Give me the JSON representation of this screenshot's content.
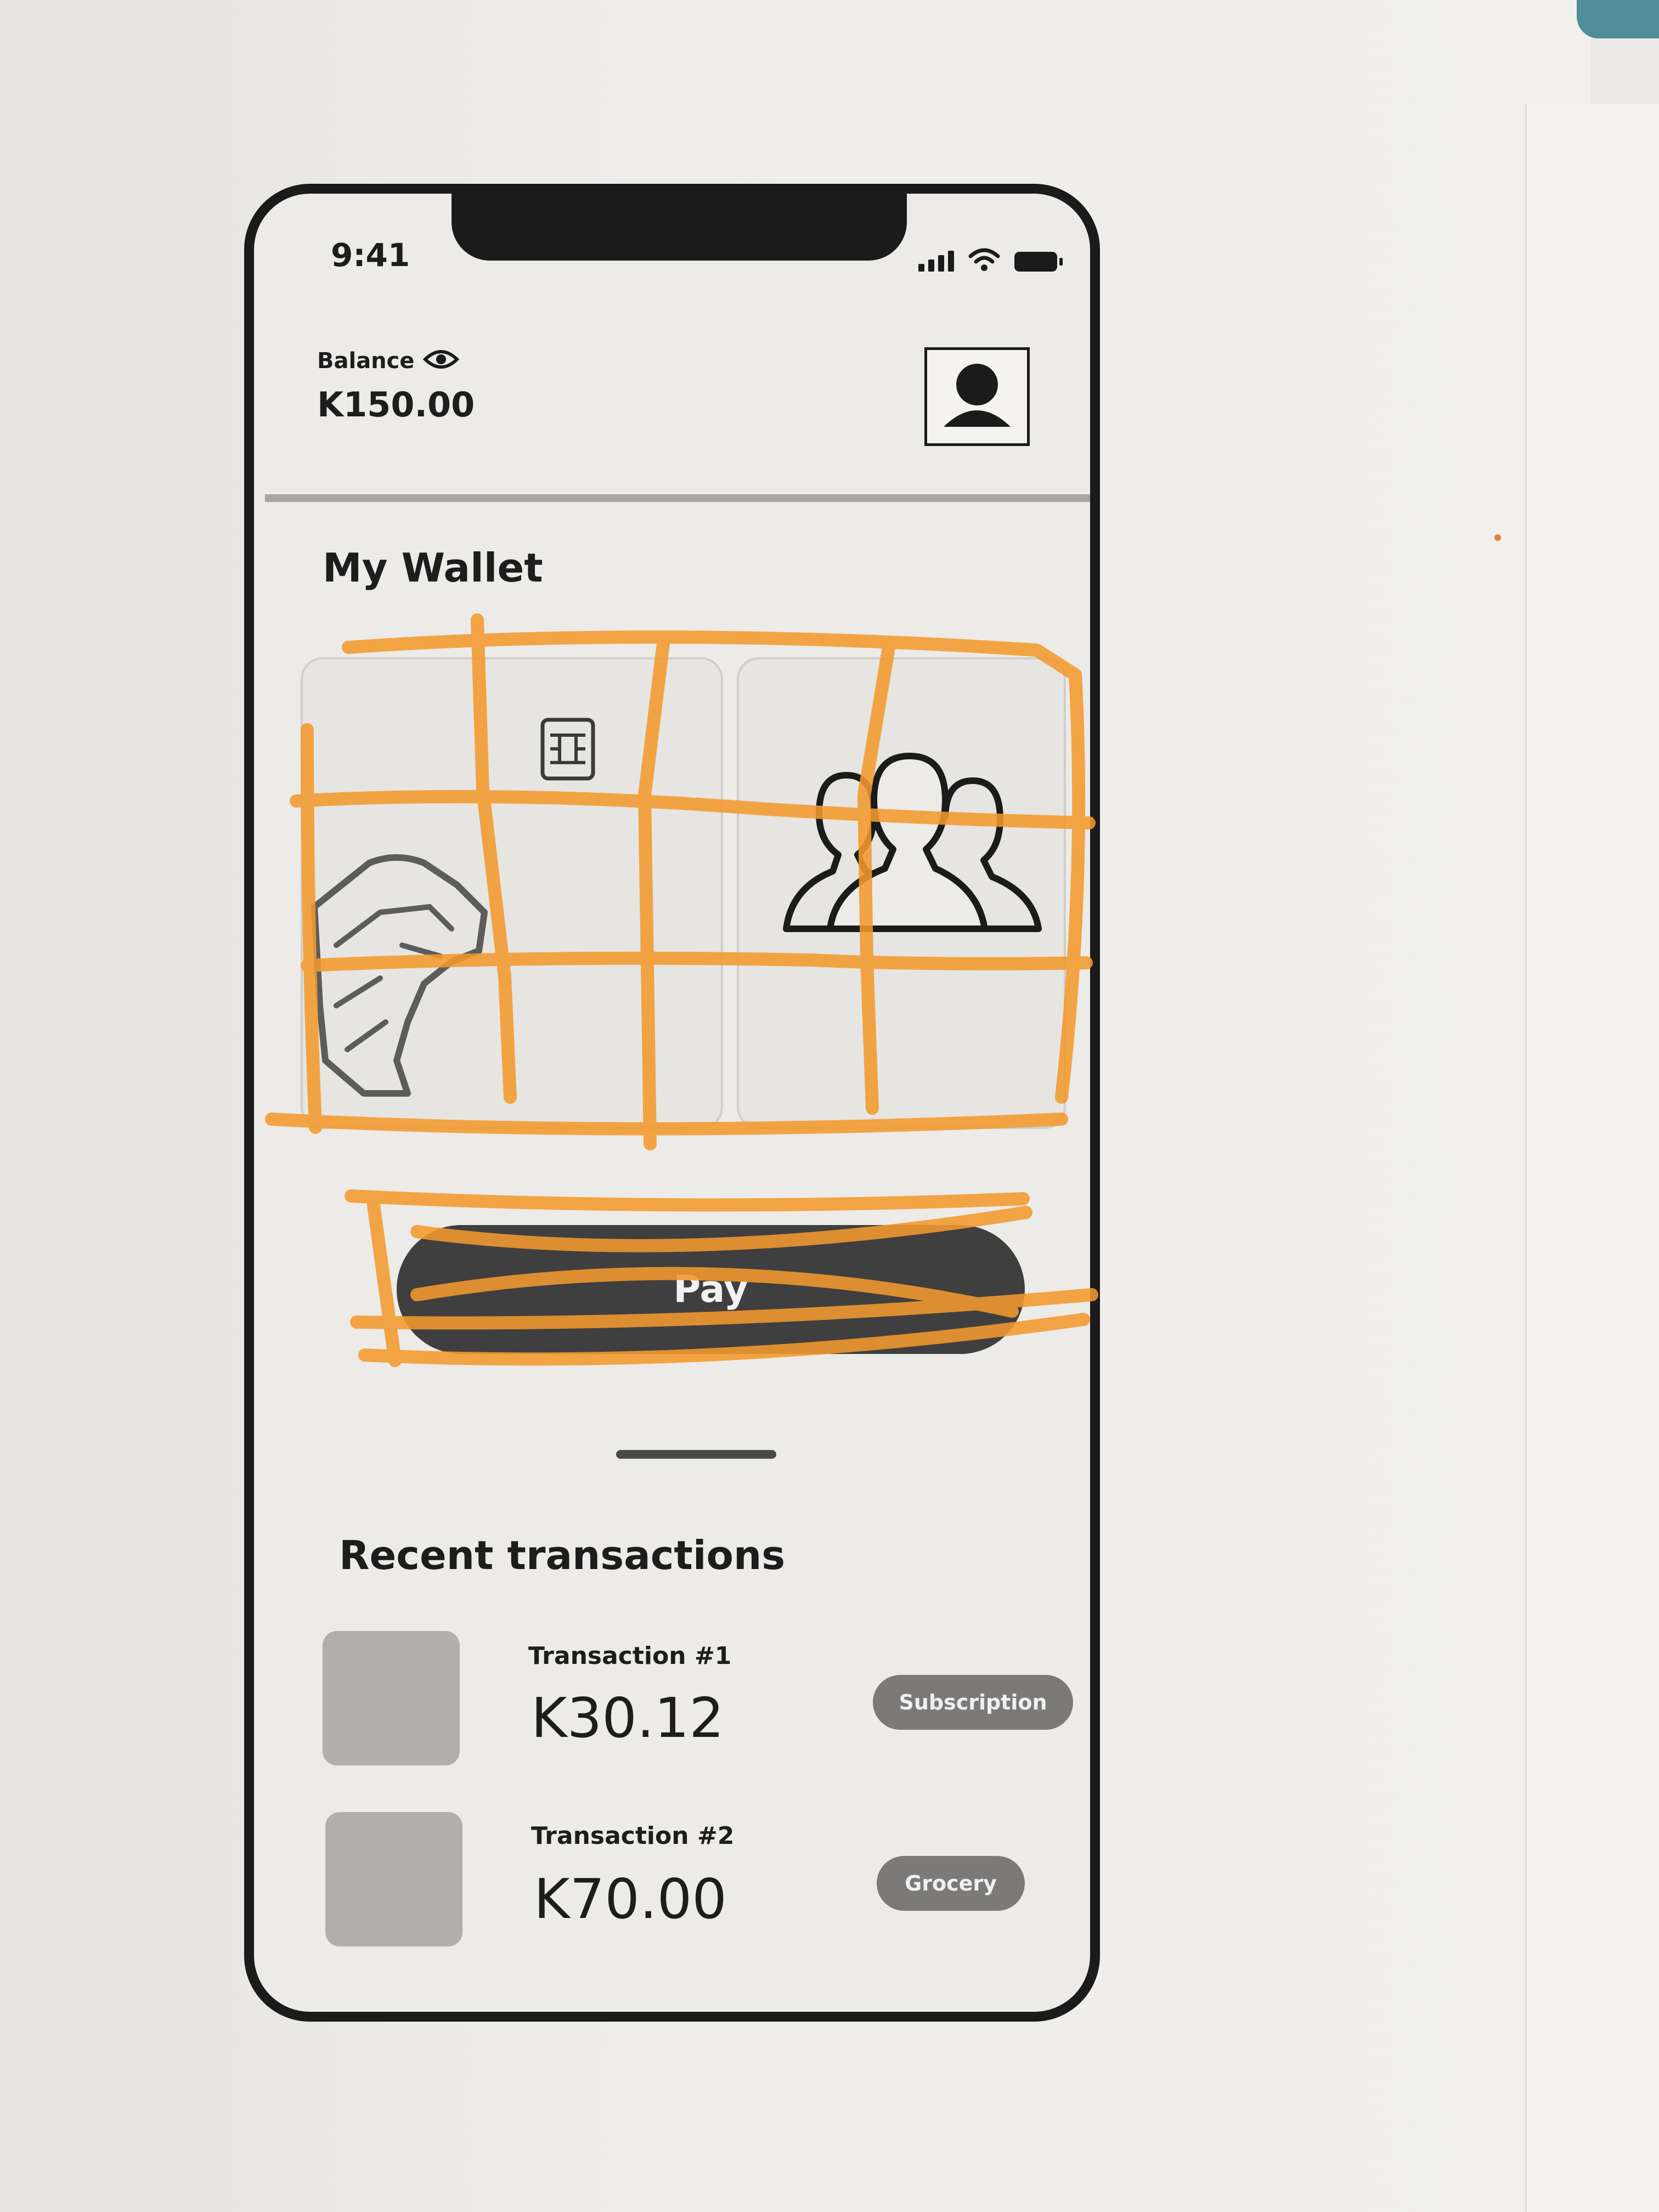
{
  "status_bar": {
    "time": "9:41"
  },
  "header": {
    "balance_label": "Balance",
    "balance_value": "K150.00",
    "icons": [
      "eye-icon",
      "user-avatar-icon"
    ]
  },
  "wallet": {
    "title": "My Wallet",
    "card_icons": [
      "card-chip-icon",
      "hand-icon",
      "people-group-icon"
    ],
    "pay_label": "Pay"
  },
  "recent": {
    "title": "Recent transactions",
    "transactions": [
      {
        "name": "Transaction #1",
        "amount": "K30.12",
        "tag": "Subscription"
      },
      {
        "name": "Transaction #2",
        "amount": "K70.00",
        "tag": "Grocery"
      }
    ]
  },
  "colors": {
    "sketch_annotation": "#f39a2e",
    "phone_frame": "#1b1b1b",
    "pay_button": "#3f3f3f"
  }
}
